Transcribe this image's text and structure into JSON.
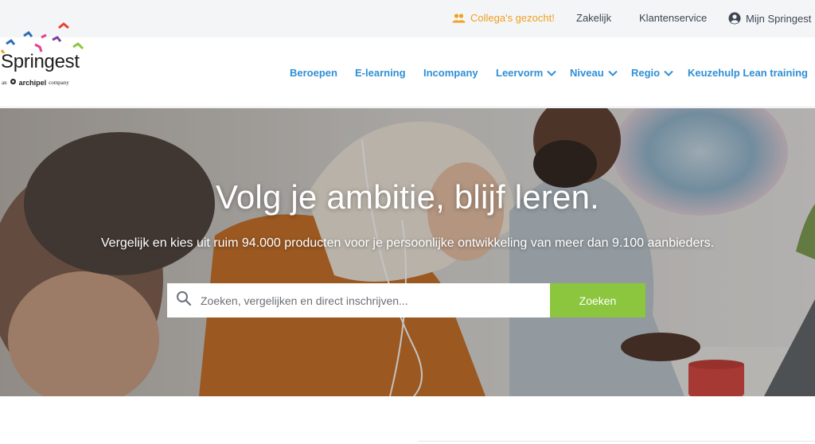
{
  "topbar": {
    "colleagues": {
      "label": "Collega's gezocht!",
      "icon": "people-icon"
    },
    "business": "Zakelijk",
    "service": "Klantenservice",
    "account": {
      "label": "Mijn Springest",
      "icon": "account-circle-icon"
    }
  },
  "logo": {
    "word": "Springest",
    "sub_prefix": "an",
    "sub_brand": "archipel",
    "sub_suffix": "company"
  },
  "nav": {
    "items": [
      {
        "label": "Beroepen",
        "dropdown": false
      },
      {
        "label": "E-learning",
        "dropdown": false
      },
      {
        "label": "Incompany",
        "dropdown": false
      },
      {
        "label": "Leervorm",
        "dropdown": true
      },
      {
        "label": "Niveau",
        "dropdown": true
      },
      {
        "label": "Regio",
        "dropdown": true
      },
      {
        "label": "Keuzehulp Lean training",
        "dropdown": false
      }
    ]
  },
  "hero": {
    "title": "Volg je ambitie, blijf leren.",
    "subtitle": "Vergelijk en kies uit ruim 94.000 producten voor je persoonlijke ontwikkeling van meer dan 9.100 aanbieders.",
    "search": {
      "placeholder": "Zoeken, vergelijken en direct inschrijven...",
      "value": "",
      "button": "Zoeken"
    }
  },
  "colors": {
    "accent_orange": "#f0a020",
    "nav_blue": "#2f8fd6",
    "search_green": "#8cc63f"
  }
}
